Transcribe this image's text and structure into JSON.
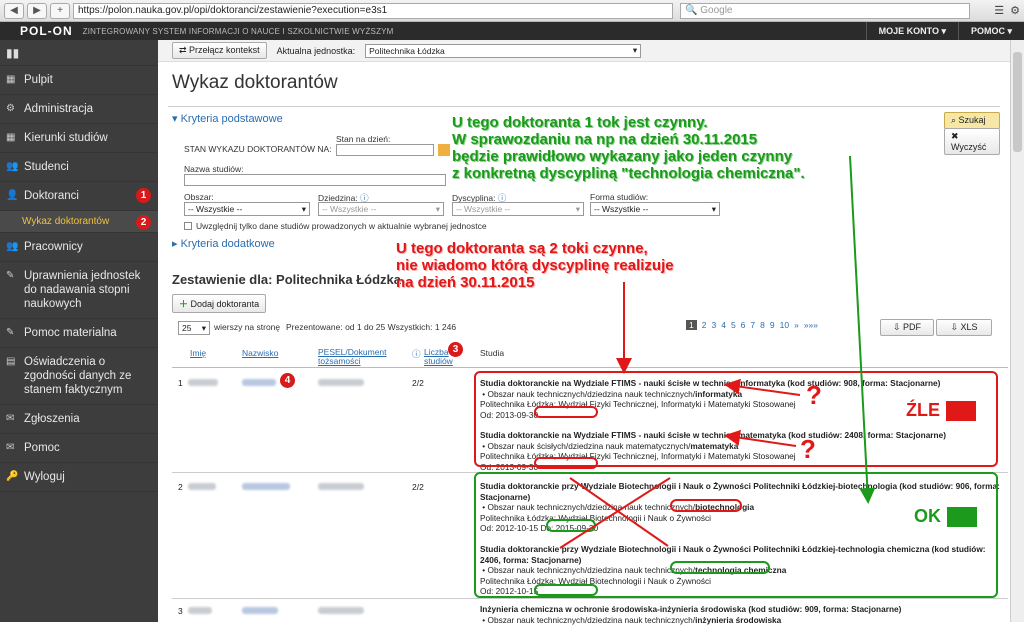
{
  "browser": {
    "url": "https://polon.nauka.gov.pl/opi/doktoranci/zestawienie?execution=e3s1",
    "search_placeholder": "Google"
  },
  "header": {
    "logo": "POL-ON",
    "subtitle": "ZINTEGROWANY SYSTEM INFORMACJI O NAUCE I SZKOLNICTWIE WYŻSZYM",
    "menu": [
      "MOJE KONTO ▾",
      "POMOC ▾"
    ]
  },
  "sidebar": {
    "items": [
      {
        "label": "Pulpit",
        "icon": "grid-icon"
      },
      {
        "label": "Administracja",
        "icon": "gear-icon"
      },
      {
        "label": "Kierunki studiów",
        "icon": "grid-icon"
      },
      {
        "label": "Studenci",
        "icon": "users-icon"
      },
      {
        "label": "Doktoranci",
        "icon": "user-icon"
      },
      {
        "label": "Pracownicy",
        "icon": "users-icon"
      },
      {
        "label": "Uprawnienia jednostek do nadawania stopni naukowych",
        "icon": "pencil-icon"
      },
      {
        "label": "Pomoc materialna",
        "icon": "pencil-icon"
      },
      {
        "label": "Oświadczenia o zgodności danych ze stanem faktycznym",
        "icon": "doc-icon"
      },
      {
        "label": "Zgłoszenia",
        "icon": "bell-icon"
      },
      {
        "label": "Pomoc",
        "icon": "bell-icon"
      },
      {
        "label": "Wyloguj",
        "icon": "key-icon"
      }
    ],
    "sub_item": "Wykaz doktorantów",
    "badges": [
      "1",
      "2"
    ]
  },
  "context": {
    "switch_btn": "Przełącz kontekst",
    "unit_label": "Aktualna jednostka:",
    "unit_value": "Politechnika Łódzka"
  },
  "page": {
    "title": "Wykaz doktorantów",
    "criteria_basic": "Kryteria podstawowe",
    "criteria_extra": "Kryteria dodatkowe",
    "stan_wykazu": "STAN WYKAZU DOKTORANTÓW NA:",
    "stan_na_dzien": "Stan na dzień:",
    "nazwa_studiow": "Nazwa studiów:",
    "obszar": "Obszar:",
    "dziedzina": "Dziedzina:",
    "dyscyplina": "Dyscyplina:",
    "forma": "Forma studiów:",
    "all": "-- Wszystkie --",
    "checkbox": "Uwzględnij tylko dane studiów prowadzonych w aktualnie wybranej jednostce",
    "search_btn": "Szukaj",
    "clear_btn": "Wyczyść",
    "summary_title": "Zestawienie dla: Politechnika Łódzka",
    "add_btn": "Dodaj doktoranta",
    "per_page": "25",
    "per_page_label": "wierszy na stronę",
    "presented": "Prezentowane: od 1 do 25 Wszystkich: 1 246",
    "pages": [
      "1",
      "2",
      "3",
      "4",
      "5",
      "6",
      "7",
      "8",
      "9",
      "10",
      "»",
      "»»»"
    ],
    "pdf": "PDF",
    "xls": "XLS"
  },
  "table": {
    "headers": {
      "imie": "Imię",
      "nazwisko": "Nazwisko",
      "pesel": "PESEL/Dokument tożsamości",
      "liczba": "Liczba studiów",
      "studia": "Studia"
    },
    "rows": [
      {
        "num": "1",
        "count": "2/2",
        "studies": [
          {
            "title": "Studia doktoranckie na Wydziale FTIMS - nauki ścisłe w technice-informatyka (kod studiów: 908, forma: Stacjonarne)",
            "area": "Obszar nauk technicznych/dziedzina nauk technicznych/",
            "discipline": "informatyka",
            "unit": "Politechnika Łódzka; Wydział Fizyki Technicznej, Informatyki i Matematyki Stosowanej",
            "from": "Od: 2013-09-30"
          },
          {
            "title": "Studia doktoranckie na Wydziale FTIMS - nauki ścisłe w technice-matematyka (kod studiów: 2408, forma: Stacjonarne)",
            "area": "Obszar nauk ścisłych/dziedzina nauk matematycznych/",
            "discipline": "matematyka",
            "unit": "Politechnika Łódzka; Wydział Fizyki Technicznej, Informatyki i Matematyki Stosowanej",
            "from": "Od: 2013-09-30"
          }
        ]
      },
      {
        "num": "2",
        "count": "2/2",
        "studies": [
          {
            "title": "Studia doktoranckie przy Wydziale Biotechnologii i Nauk o Żywności Politechniki Łódzkiej-biotechnologia (kod studiów: 906, forma: Stacjonarne)",
            "area": "Obszar nauk technicznych/dziedzina nauk technicznych/",
            "discipline": "biotechnologia",
            "unit": "Politechnika Łódzka; Wydział Biotechnologii i Nauk o Żywności",
            "from": "Od: 2012-10-15",
            "to_label": "Do:",
            "to": "2015-09-30"
          },
          {
            "title": "Studia doktoranckie przy Wydziale Biotechnologii i Nauk o Żywności Politechniki Łódzkiej-technologia chemiczna (kod studiów: 2406, forma: Stacjonarne)",
            "area": "Obszar nauk technicznych/dziedzina nauk technicznych/",
            "discipline": "technologia chemiczna",
            "unit": "Politechnika Łódzka; Wydział Biotechnologii i Nauk o Żywności",
            "from": "Od: 2012-10-15"
          }
        ]
      },
      {
        "num": "3",
        "studies": [
          {
            "title": "Inżynieria chemiczna w ochronie środowiska-inżynieria środowiska (kod studiów: 909, forma: Stacjonarne)",
            "area": "Obszar nauk technicznych/dziedzina nauk technicznych/",
            "discipline": "inżynieria środowiska"
          }
        ]
      }
    ]
  },
  "annotations": {
    "green_note": [
      "U tego doktoranta 1 tok jest czynny.",
      "W sprawozdaniu na np na dzień 30.11.2015",
      "będzie prawidłowo wykazany jako jeden czynny",
      "z konkretną dyscypliną \"technologia chemiczna\"."
    ],
    "red_note": [
      "U tego doktoranta są 2 toki czynne,",
      "nie wiadomo którą dyscyplinę realizuje",
      "na dzień 30.11.2015"
    ],
    "bad_label": "ŹLE",
    "good_label": "OK",
    "qmark": "?",
    "badge3": "3",
    "badge4": "4",
    "colors": {
      "red": "#e01818",
      "green": "#1b9a1b"
    }
  }
}
